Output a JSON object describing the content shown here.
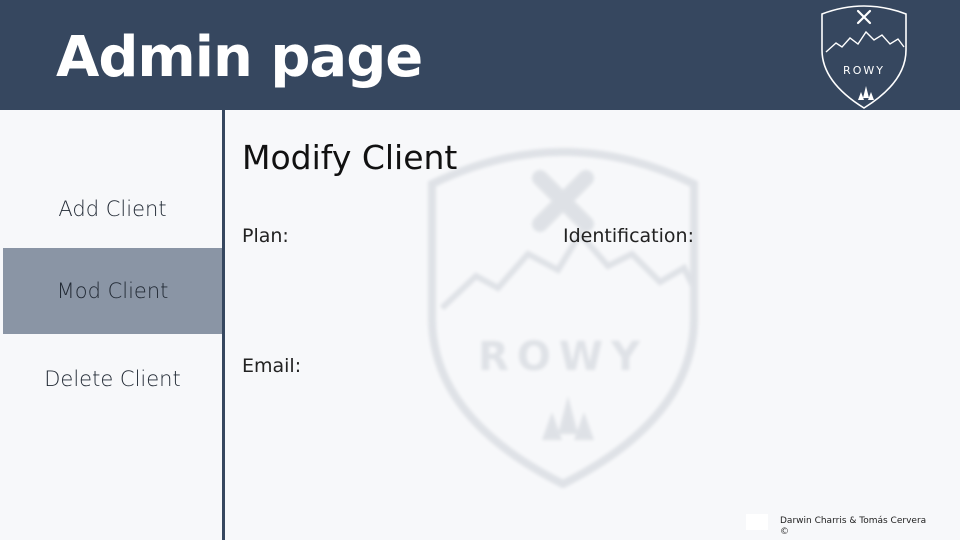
{
  "header": {
    "title": "Admin page",
    "logo_text": "ROWY"
  },
  "sidebar": {
    "items": [
      {
        "label": "Add Client",
        "active": false
      },
      {
        "label": "Mod Client",
        "active": true
      },
      {
        "label": "Delete Client",
        "active": false
      }
    ]
  },
  "main": {
    "title": "Modify Client",
    "fields": {
      "plan_label": "Plan:",
      "identification_label": "Identification:",
      "email_label": "Email:"
    },
    "watermark_text": "ROWY"
  },
  "footer": {
    "credit": "Darwin Charris & Tomás Cervera ©"
  },
  "colors": {
    "header_bg": "#36475f",
    "active_nav_bg": "#8a95a5",
    "page_bg": "#f7f8fa"
  },
  "icons": {
    "logo": "rowy-mountain-shield-icon",
    "watermark": "rowy-mountain-shield-icon"
  }
}
